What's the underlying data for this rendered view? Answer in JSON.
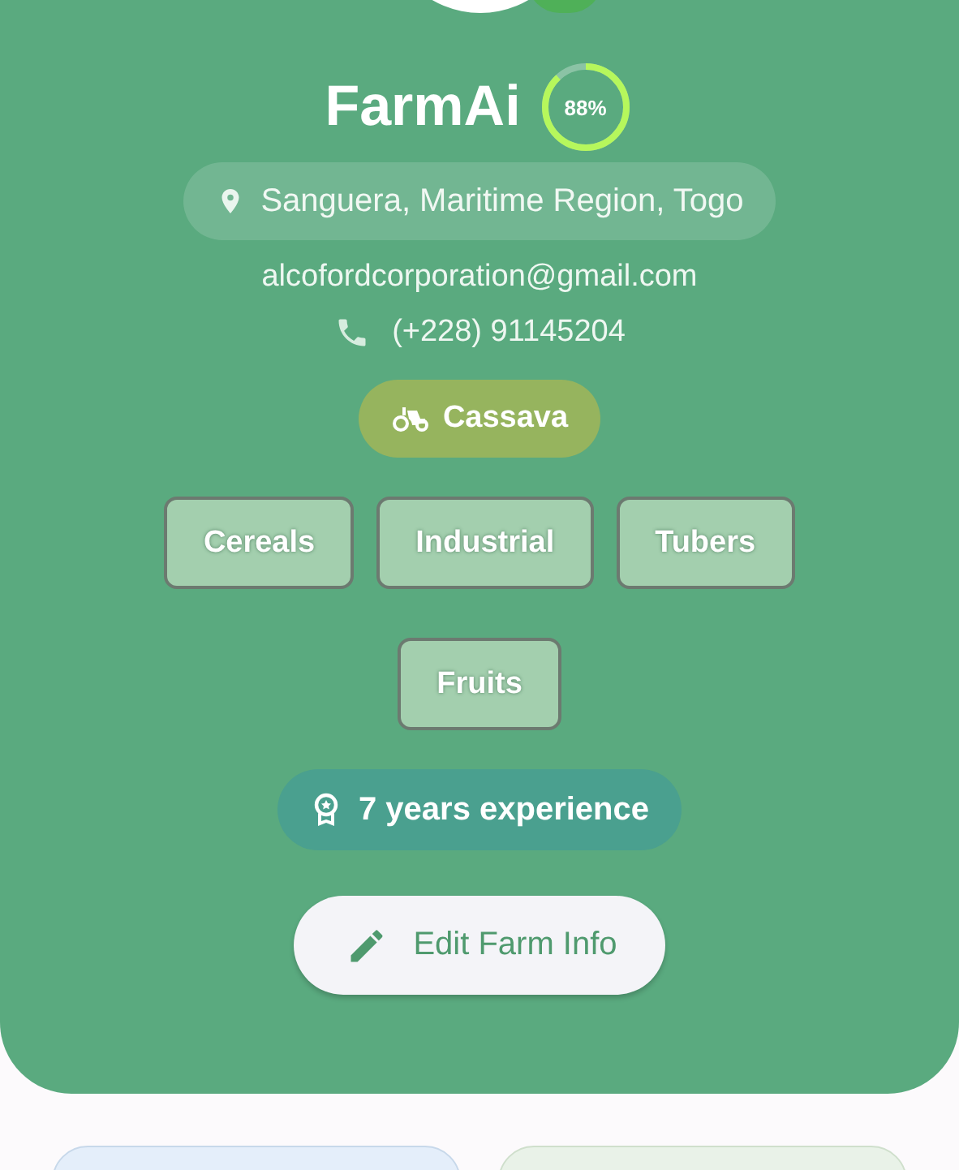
{
  "profile": {
    "name": "FarmAi",
    "completion": {
      "level": 0.88,
      "reading": "88%"
    },
    "location": "Sanguera, Maritime Region, Togo",
    "email": "alcofordcorporation@gmail.com",
    "phone": "(+228) 91145204",
    "main_crop": "Cassava",
    "categories": [
      "Cereals",
      "Industrial",
      "Tubers",
      "Fruits"
    ],
    "experience": "7 years experience"
  },
  "edit_button": "Edit Farm Info"
}
